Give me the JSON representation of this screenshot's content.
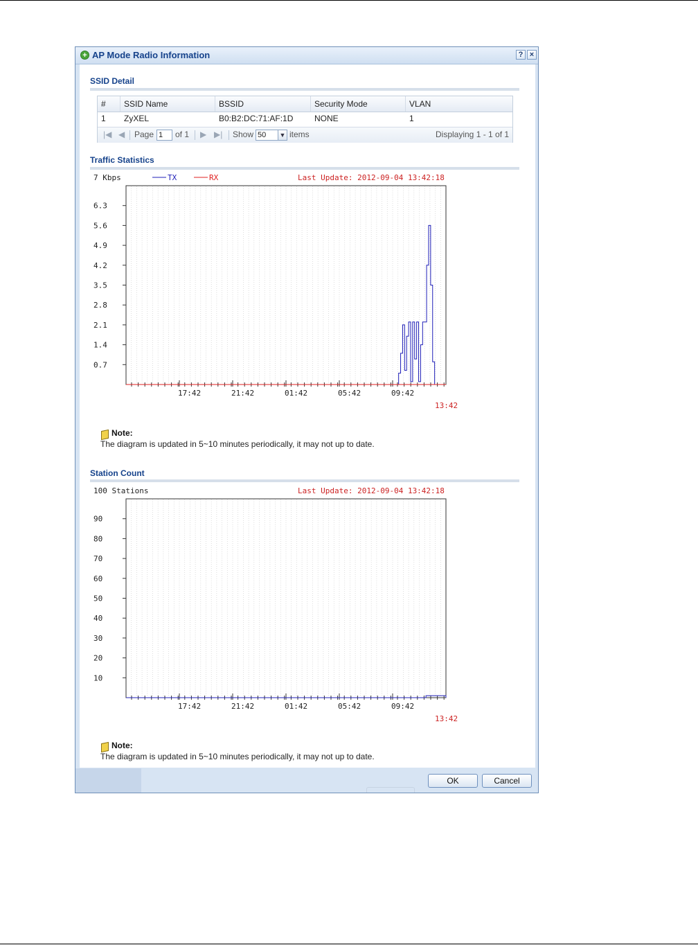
{
  "dialog": {
    "title": "AP Mode Radio Information",
    "help_label": "?",
    "close_label": "×"
  },
  "ssid_detail": {
    "title": "SSID Detail",
    "columns": [
      "#",
      "SSID Name",
      "BSSID",
      "Security Mode",
      "VLAN"
    ],
    "rows": [
      [
        "1",
        "ZyXEL",
        "B0:B2:DC:71:AF:1D",
        "NONE",
        "1"
      ]
    ],
    "pager": {
      "page_label": "Page",
      "page_value": "1",
      "of_label": "of 1",
      "show_label": "Show",
      "show_value": "50",
      "items_label": "items",
      "displaying": "Displaying 1 - 1 of 1"
    }
  },
  "traffic": {
    "title": "Traffic Statistics",
    "note_title": "Note:",
    "note_text": "The diagram is updated in 5~10 minutes periodically, it may not up to date."
  },
  "station": {
    "title": "Station Count",
    "note_title": "Note:",
    "note_text": "The diagram is updated in 5~10 minutes periodically, it may not up to date."
  },
  "buttons": {
    "ok": "OK",
    "cancel": "Cancel"
  },
  "chart_data": [
    {
      "type": "line",
      "ylabel": "7 Kbps",
      "last_update": "Last Update: 2012-09-04 13:42:18",
      "yticks": [
        "6.3",
        "5.6",
        "4.9",
        "4.2",
        "3.5",
        "2.8",
        "2.1",
        "1.4",
        "0.7"
      ],
      "xticks": [
        "17:42",
        "21:42",
        "01:42",
        "05:42",
        "09:42"
      ],
      "xlast": "13:42",
      "ylim": [
        0,
        7
      ],
      "grid": true,
      "legend_placement": "top",
      "x_hours": [
        0,
        20.3,
        20.45,
        20.6,
        20.75,
        20.9,
        21.05,
        21.2,
        21.35,
        21.5,
        21.65,
        21.8,
        21.95,
        22.1,
        22.25,
        22.4,
        22.55,
        22.7,
        22.85,
        23.0,
        23.15,
        23.3,
        23.5,
        24
      ],
      "series": [
        {
          "name": "TX",
          "color": "#1f1fb8",
          "values": [
            0,
            0,
            0.4,
            1.1,
            2.1,
            0.5,
            1.7,
            2.2,
            0.1,
            2.2,
            0.9,
            2.2,
            0.1,
            1.4,
            2.2,
            2.2,
            4.2,
            5.6,
            3.5,
            0.8,
            0,
            0,
            0,
            0
          ]
        },
        {
          "name": "RX",
          "color": "#e02020",
          "values": [
            0,
            0,
            0,
            0,
            0,
            0,
            0,
            0,
            0,
            0,
            0,
            0,
            0,
            0,
            0,
            0,
            0,
            0,
            0,
            0,
            0,
            0,
            0,
            0
          ]
        }
      ]
    },
    {
      "type": "line",
      "ylabel": "100 Stations",
      "last_update": "Last Update: 2012-09-04 13:42:18",
      "yticks": [
        "90",
        "80",
        "70",
        "60",
        "50",
        "40",
        "30",
        "20",
        "10"
      ],
      "xticks": [
        "17:42",
        "21:42",
        "01:42",
        "05:42",
        "09:42"
      ],
      "xlast": "13:42",
      "ylim": [
        0,
        100
      ],
      "grid": true,
      "x_hours": [
        0,
        22.0,
        22.5,
        23.5,
        24
      ],
      "series": [
        {
          "color": "#1f1fb8",
          "values": [
            0,
            0,
            1,
            1,
            0
          ]
        }
      ]
    }
  ]
}
